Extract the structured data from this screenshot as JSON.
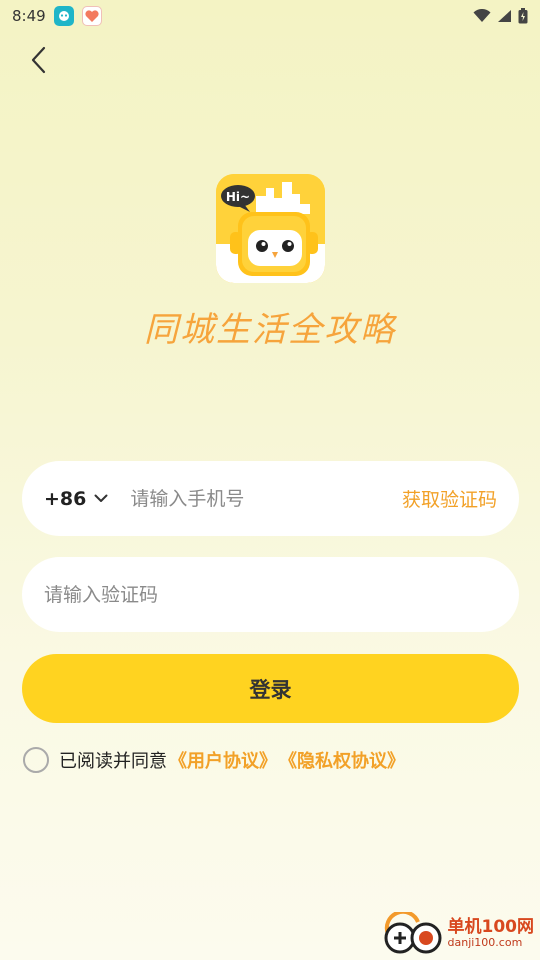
{
  "status_bar": {
    "time": "8:49"
  },
  "app": {
    "slogan": "同城生活全攻略",
    "logo_text": "Hi~"
  },
  "login_form": {
    "country_code": "+86",
    "phone_placeholder": "请输入手机号",
    "get_code_label": "获取验证码",
    "code_placeholder": "请输入验证码",
    "login_label": "登录"
  },
  "agreement": {
    "prefix": "已阅读并同意",
    "user_agreement": "《用户协议》",
    "privacy_policy": "《隐私权协议》"
  },
  "watermark": {
    "cn": "单机100网",
    "en": "danji100.com"
  },
  "colors": {
    "accent": "#f2a128",
    "button": "#ffd320"
  }
}
